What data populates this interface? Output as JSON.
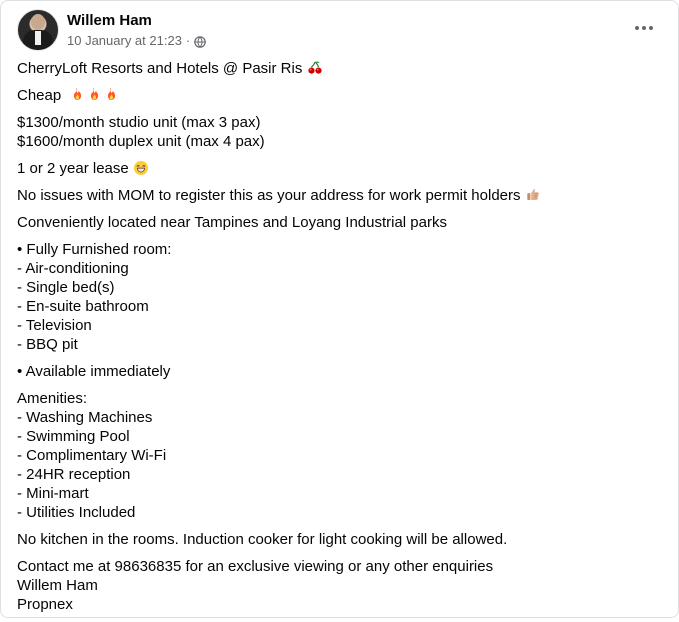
{
  "author": {
    "name": "Willem Ham",
    "timestamp": "10 January at 21:23",
    "separator": "·"
  },
  "post": {
    "title": "CherryLoft Resorts and Hotels @ Pasir Ris",
    "cheap": "Cheap",
    "prices": [
      "$1300/month studio unit (max 3 pax)",
      "$1600/month duplex unit (max 4 pax)"
    ],
    "lease": "1 or 2 year lease",
    "mom": "No issues with MOM to register this as your address for work permit holders",
    "location": "Conveniently located near Tampines and Loyang Industrial parks",
    "furnished": [
      "• Fully Furnished room:",
      "- Air-conditioning",
      "- Single bed(s)",
      "- En-suite bathroom",
      "- Television",
      "- BBQ pit"
    ],
    "availability": "• Available immediately",
    "amenities": [
      "Amenities:",
      "- Washing Machines",
      "- Swimming Pool",
      "- Complimentary Wi-Fi",
      "- 24HR reception",
      "- Mini-mart",
      "- Utilities Included"
    ],
    "kitchen": "No kitchen in the rooms. Induction cooker for light cooking will be allowed.",
    "contact": [
      "Contact me at 98636835 for an exclusive viewing or any other enquiries",
      "Willem Ham",
      "Propnex"
    ]
  },
  "icons": {
    "audience": "globe-icon",
    "more": "more-options-icon",
    "cherry": "cherry-icon",
    "fire": "fire-icon",
    "grin": "grinning-face-icon",
    "thumb": "thumbs-up-icon"
  }
}
